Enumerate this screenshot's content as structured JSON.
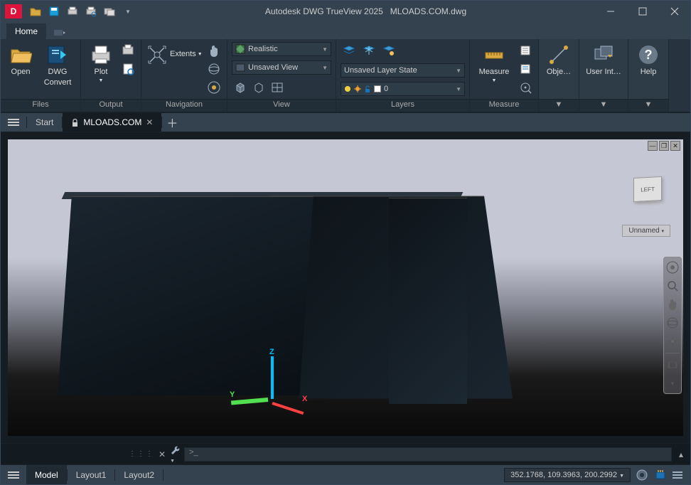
{
  "title": {
    "app": "Autodesk DWG TrueView 2025",
    "file": "MLOADS.COM.dwg"
  },
  "tabs": {
    "home": "Home"
  },
  "ribbon": {
    "files": {
      "title": "Files",
      "open": "Open",
      "convert_l1": "DWG",
      "convert_l2": "Convert"
    },
    "output": {
      "title": "Output",
      "plot": "Plot"
    },
    "navigation": {
      "title": "Navigation",
      "extents": "Extents"
    },
    "view": {
      "title": "View",
      "visual_style": "Realistic",
      "named_view": "Unsaved View"
    },
    "layers": {
      "title": "Layers",
      "state": "Unsaved Layer State",
      "current": "0"
    },
    "measure": {
      "title": "Measure",
      "btn": "Measure"
    },
    "objects": {
      "title": " ",
      "btn": "Obje…"
    },
    "ui": {
      "title": " ",
      "btn": "User Int…"
    },
    "help": {
      "title": " ",
      "btn": "Help"
    }
  },
  "docs": {
    "start": "Start",
    "active": "MLOADS.COM"
  },
  "viewport": {
    "cube_face": "LEFT",
    "named": "Unnamed"
  },
  "axes": {
    "x": "X",
    "y": "Y",
    "z": "Z"
  },
  "layouts": {
    "model": "Model",
    "l1": "Layout1",
    "l2": "Layout2"
  },
  "status": {
    "coords": "352.1768, 109.3963, 200.2992"
  }
}
